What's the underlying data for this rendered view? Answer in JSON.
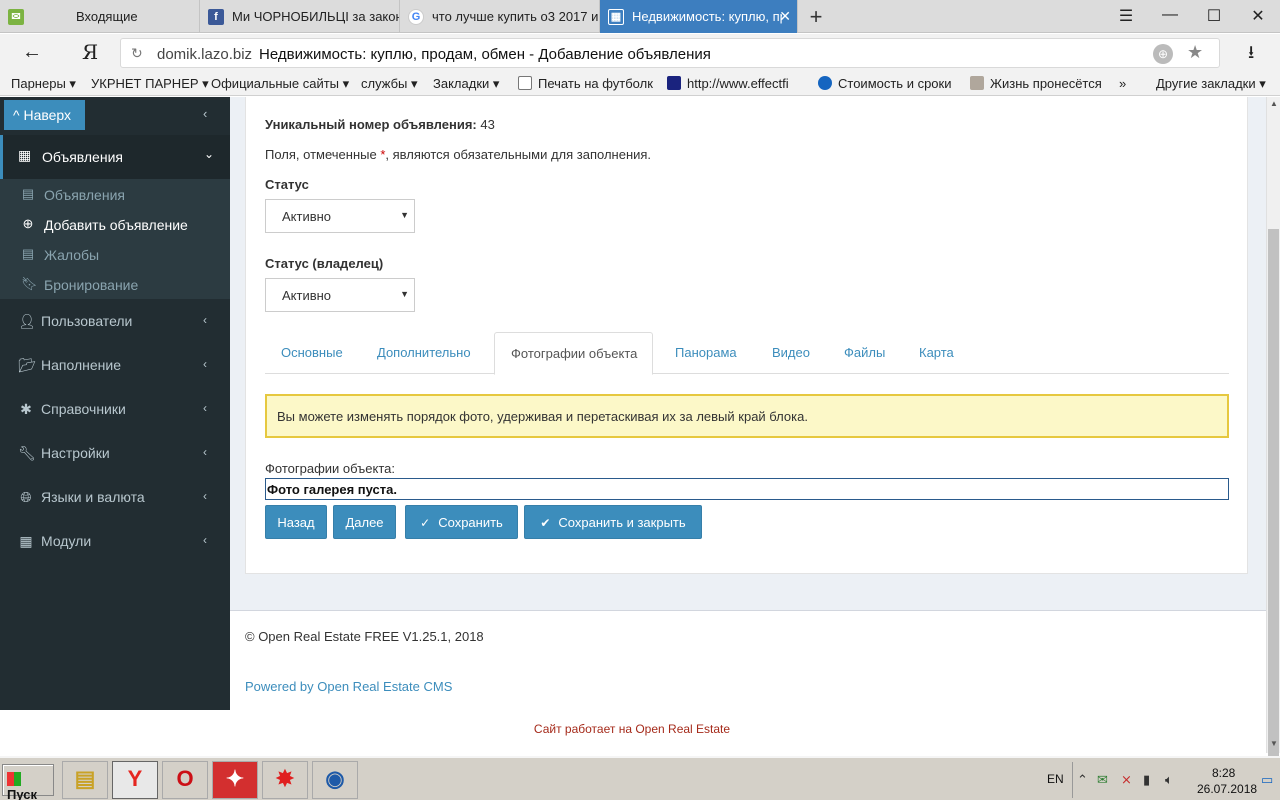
{
  "browser": {
    "tabs": [
      {
        "title": "Входящие",
        "icon": "mail-icon"
      },
      {
        "title": "Ми ЧОРНОБИЛЬЦІ за закон",
        "icon": "facebook-icon"
      },
      {
        "title": "что лучше купить о3 2017 и",
        "icon": "google-icon"
      },
      {
        "title": "Недвижимость: куплю, пр",
        "icon": "site-icon",
        "active": true
      }
    ],
    "url_domain": "domik.lazo.biz",
    "url_title": "Недвижимость: куплю, продам, обмен - Добавление объявления",
    "bookmarks": [
      "Парнеры ▾",
      "УКРНЕТ ПАРНЕР ▾",
      "Официальные сайты ▾",
      "службы ▾",
      "Закладки ▾",
      "Печать на футболк",
      "http://www.effectfi",
      "Стоимость и сроки",
      "Жизнь пронесётся",
      "»",
      "Другие закладки ▾"
    ]
  },
  "sidebar": {
    "back_button": "^ Наверх",
    "active_section": "Объявления",
    "subitems": [
      {
        "label": "Объявления",
        "icon": "list-icon"
      },
      {
        "label": "Добавить объявление",
        "icon": "plus-circle-icon",
        "current": true
      },
      {
        "label": "Жалобы",
        "icon": "list-icon"
      },
      {
        "label": "Бронирование",
        "icon": "bookmark-icon"
      }
    ],
    "items": [
      {
        "label": "Пользователи",
        "icon": "user-icon"
      },
      {
        "label": "Наполнение",
        "icon": "folder-icon"
      },
      {
        "label": "Справочники",
        "icon": "asterisk-icon"
      },
      {
        "label": "Настройки",
        "icon": "wrench-icon"
      },
      {
        "label": "Языки и валюта",
        "icon": "globe-icon"
      },
      {
        "label": "Модули",
        "icon": "grid-icon"
      }
    ]
  },
  "form": {
    "ad_number_label": "Уникальный номер объявления:",
    "ad_number_value": "43",
    "required_note_before": "Поля, отмеченные",
    "required_star": "*",
    "required_note_after": ", являются обязательными для заполнения.",
    "status_label": "Статус",
    "status_value": "Активно",
    "owner_status_label": "Статус (владелец)",
    "owner_status_value": "Активно",
    "tabs": [
      "Основные",
      "Дополнительно",
      "Фотографии объекта",
      "Панорама",
      "Видео",
      "Файлы",
      "Карта"
    ],
    "active_tab": "Фотографии объекта",
    "alert": "Вы можете изменять порядок фото, удерживая и перетаскивая их за левый край блока.",
    "photos_label": "Фотографии объекта:",
    "gallery_empty": "Фото галерея пуста.",
    "buttons": {
      "back": "Назад",
      "next": "Далее",
      "save": "Сохранить",
      "save_close": "Сохранить и закрыть"
    }
  },
  "footer": {
    "copyright": "© Open Real Estate FREE V1.25.1, 2018",
    "powered": "Powered by Open Real Estate CMS",
    "site_note": "Сайт работает на Open Real Estate"
  },
  "taskbar": {
    "start": "Пуск",
    "language": "EN",
    "time": "8:28",
    "date": "26.07.2018"
  },
  "colors": {
    "accent": "#3c8dbc",
    "sidebar_bg": "#222d32",
    "alert_bg": "#fcf8c8",
    "alert_border": "#e6c83f"
  }
}
